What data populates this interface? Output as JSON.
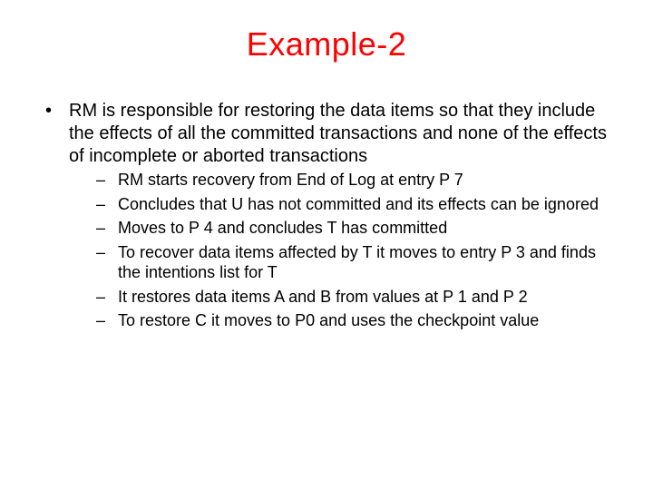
{
  "title": "Example-2",
  "main_bullet": "RM is responsible for restoring the data items so that they include the effects of all the committed transactions and none of the effects of incomplete or aborted transactions",
  "sub_bullets": [
    "RM starts recovery from End of Log at entry P 7",
    "Concludes that U has not committed and its effects can be ignored",
    "Moves to P 4 and concludes T has committed",
    "To recover data items affected by T it moves to entry P 3 and finds the intentions list for T",
    "It restores data items A and B from values at P 1 and P 2",
    "To restore C it moves to P0 and uses the checkpoint value"
  ]
}
